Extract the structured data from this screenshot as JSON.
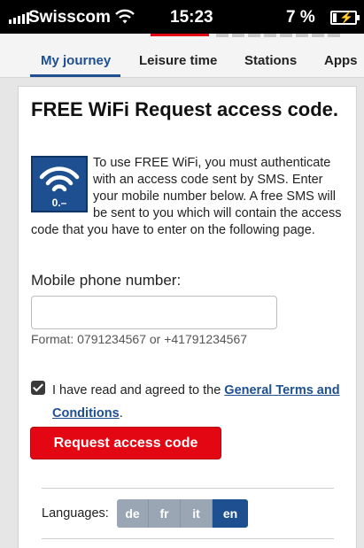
{
  "status_bar": {
    "carrier": "Swisscom",
    "time": "15:23",
    "battery": "7 %"
  },
  "nav": {
    "items": [
      {
        "label": "My journey",
        "active": true
      },
      {
        "label": "Leisure time",
        "active": false
      },
      {
        "label": "Stations",
        "active": false
      },
      {
        "label": "Apps",
        "active": false
      }
    ]
  },
  "page": {
    "title": "FREE WiFi Request access code.",
    "intro": "To use FREE WiFi, you must authenticate with an access code sent by SMS. Enter your mobile number below. A free SMS will be sent to you which will contain the access code that you have to enter on the following page.",
    "wifi_logo_text": "0.–"
  },
  "form": {
    "phone_label": "Mobile phone number:",
    "phone_value": "",
    "format_hint": "Format: 0791234567 or +41791234567",
    "terms_prefix": "I have read and agreed to the ",
    "terms_link": "General Terms and Conditions",
    "terms_suffix": ".",
    "terms_checked": true,
    "submit_label": "Request access code"
  },
  "languages": {
    "label": "Languages:",
    "options": [
      "de",
      "fr",
      "it",
      "en"
    ],
    "selected": "en"
  },
  "colors": {
    "brand_red": "#e30613",
    "brand_blue": "#1d4f91"
  }
}
